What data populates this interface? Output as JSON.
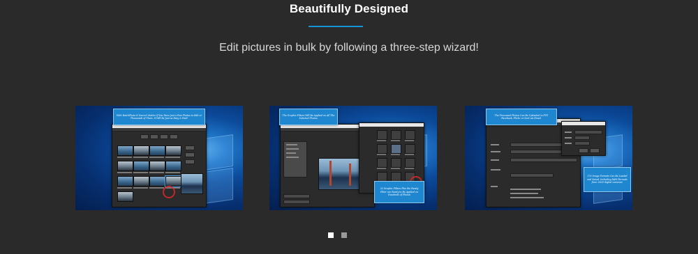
{
  "section": {
    "title": "Beautifully Designed",
    "subtitle": "Edit pictures in bulk by following a three-step wizard!"
  },
  "colors": {
    "accent": "#1593d8",
    "background": "#2a2a2a",
    "dot_active": "#ffffff",
    "dot_inactive": "#9a9a9a"
  },
  "slides": [
    {
      "callouts": [
        "With BatchPhoto It Doesn't Matter If You Have Just a Few Photos to Edit or Thousands of Them. It Will Be Just as Easy & Fast!"
      ]
    },
    {
      "callouts": [
        "The Graphic Filters Will Be Applied on All The Selected Photos.",
        "20 Graphic Filters Plus the Ready Filter are Ready to Be Applied on Hundreds of Photos"
      ]
    },
    {
      "callouts": [
        "The Processed Photos Can Be Uploaded to FTP, Facebook, Flickr, or Sent via Email.",
        "170 Image Formats Can Be Loaded and Saved, Including RAW Formats from 20LD digital cameras!"
      ]
    }
  ],
  "carousel": {
    "pages": 2,
    "active_page": 1
  }
}
